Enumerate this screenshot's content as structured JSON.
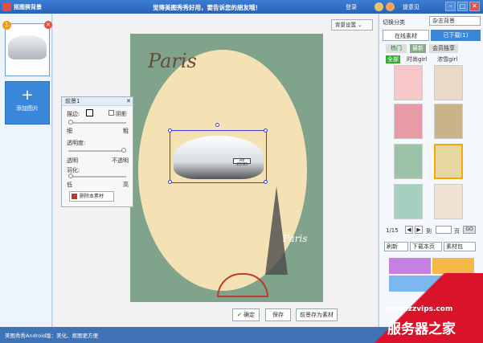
{
  "titlebar": {
    "app_title": "抠图换背景",
    "slogan": "觉得美图秀秀好用，要告诉您的朋友哦！",
    "login": "登录",
    "feedback": "提意见",
    "min": "–",
    "max": "□",
    "close": "✕"
  },
  "thumbs": {
    "badge": "1",
    "del": "✕",
    "add_label": "添加图片",
    "add_plus": "+"
  },
  "canvas": {
    "bg_settings": "背景设置 ⌄",
    "paris_top": "Paris",
    "paris_bottom": "Paris",
    "plate": "A8 2D3D"
  },
  "ctrl": {
    "title": "前景1",
    "close": "✕",
    "border": "描边:",
    "shadow": "阴影",
    "thin": "细",
    "thick": "粗",
    "transparency": "透明度:",
    "transparent": "透明",
    "opaque": "不透明",
    "feather": "羽化:",
    "low": "低",
    "high": "高",
    "delete_btn": "删除本素材",
    "transparency_value": 1.0,
    "feather_value": 0.0
  },
  "right": {
    "category_label": "切换分类",
    "category_value": "杂志背景",
    "tab_online": "在线素材",
    "tab_downloaded": "已下载(1)",
    "subtabs": [
      "热门",
      "最新",
      "会员独享"
    ],
    "filters": [
      "全部",
      "时尚girl",
      "浓雪girl"
    ],
    "page_current": "1/15",
    "page_to": "到",
    "page_unit": "页",
    "go": "GO",
    "refresh": "刷新",
    "download_page": "下载本页",
    "material_pack": "素材包"
  },
  "bottom": {
    "confirm": "确定",
    "save": "保存",
    "save_as_material": "前景存为素材"
  },
  "status": {
    "text": "美图秀秀Android版：美化、抠图更方便"
  },
  "watermark": {
    "url": "www.zzvips.com",
    "brand": "服务器之家"
  },
  "colors": {
    "titlebar": "#2a63b8",
    "accent": "#3a86d8",
    "poster_bg": "#7fa38b",
    "poster_oval": "#f4e2b5",
    "watermark_red": "#d9142a"
  }
}
